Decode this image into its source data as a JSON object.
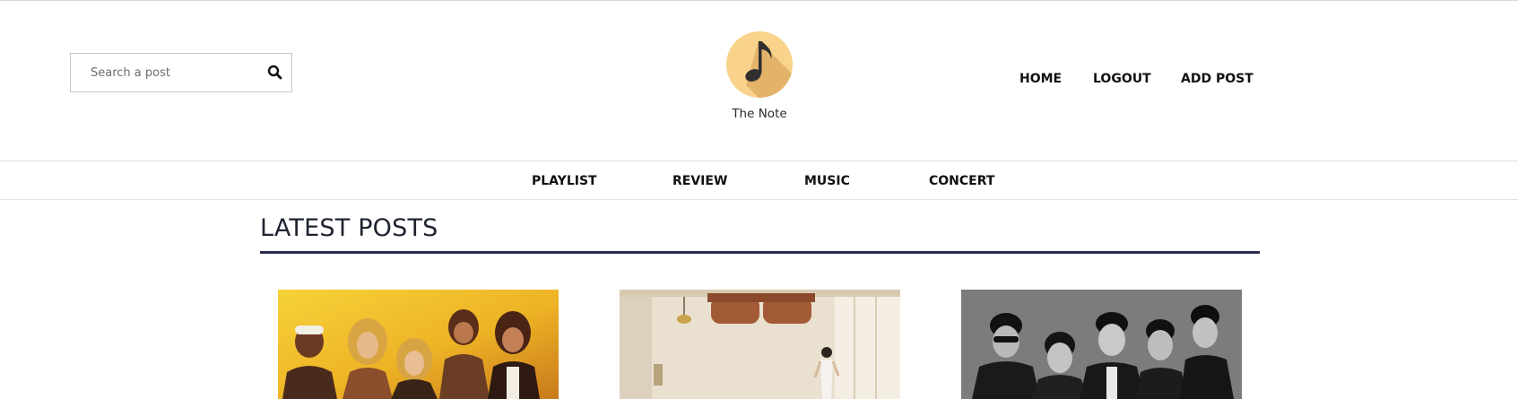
{
  "header": {
    "search": {
      "placeholder": "Search a post",
      "icon": "search-icon"
    },
    "brand": {
      "name": "The Note",
      "logo_icon": "music-note-icon",
      "logo_color": "#f9d38b"
    },
    "nav": [
      {
        "label": "HOME"
      },
      {
        "label": "LOGOUT"
      },
      {
        "label": "ADD POST"
      }
    ]
  },
  "categories": [
    {
      "label": "PLAYLIST"
    },
    {
      "label": "REVIEW"
    },
    {
      "label": "MUSIC"
    },
    {
      "label": "CONCERT"
    }
  ],
  "latest": {
    "title": "LATEST POSTS",
    "accent": "#2a2d4f",
    "posts": [
      {
        "image": "band-photo-yellow"
      },
      {
        "image": "room-photo"
      },
      {
        "image": "band-photo-bw"
      }
    ]
  }
}
